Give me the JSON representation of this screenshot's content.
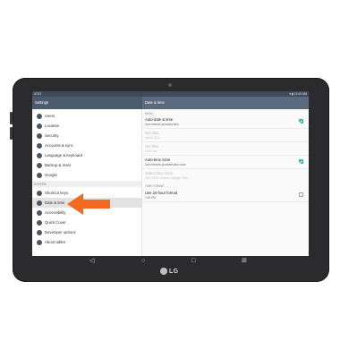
{
  "status_bar": {
    "carrier": "AT&T",
    "time": "12:00 AM",
    "indicators": "▾ ▮"
  },
  "left_panel": {
    "title": "Settings",
    "items_top": [
      {
        "label": "Users",
        "icon": "users-icon"
      },
      {
        "label": "Location",
        "icon": "location-icon"
      },
      {
        "label": "Security",
        "icon": "lock-icon"
      },
      {
        "label": "Accounts & sync",
        "icon": "sync-icon"
      },
      {
        "label": "Language & keyboard",
        "icon": "keyboard-icon"
      },
      {
        "label": "Backup & reset",
        "icon": "backup-icon"
      },
      {
        "label": "Google",
        "icon": "google-icon"
      }
    ],
    "section_system": "SYSTEM",
    "items_system": [
      {
        "label": "Shortcut keys",
        "icon": "shortcut-icon"
      },
      {
        "label": "Date & time",
        "icon": "clock-icon",
        "selected": true
      },
      {
        "label": "Accessibility",
        "icon": "accessibility-icon"
      },
      {
        "label": "Quick Cover",
        "icon": "cover-icon"
      },
      {
        "label": "Developer options",
        "icon": "developer-icon"
      },
      {
        "label": "About tablet",
        "icon": "info-icon"
      }
    ]
  },
  "right_panel": {
    "title": "Date & time",
    "section_basic": "BASIC",
    "auto_date": {
      "title": "Auto-date & time",
      "summary": "Use network-provided time",
      "checked": true
    },
    "set_date": {
      "title": "Set date",
      "summary": "March 2016"
    },
    "set_time": {
      "title": "Set time",
      "summary": "12:00 AM"
    },
    "auto_zone": {
      "title": "Auto-time zone",
      "summary": "Use network-provided time zone",
      "checked": true
    },
    "select_zone": {
      "title": "Select time zone",
      "summary": "GMT-05:00 Eastern Daylight Time"
    },
    "section_format": "TIME FORMAT",
    "use_24": {
      "title": "Use 24-hour format",
      "summary": "1:00 PM",
      "checked": false
    }
  },
  "navbar": {
    "back": "◁",
    "home": "○",
    "recents": "□",
    "extra": "⊞"
  },
  "device": {
    "brand": "LG"
  },
  "colors": {
    "accent": "#34b0ad",
    "callout": "#f26a21",
    "appbar": "#4d5b6e"
  }
}
